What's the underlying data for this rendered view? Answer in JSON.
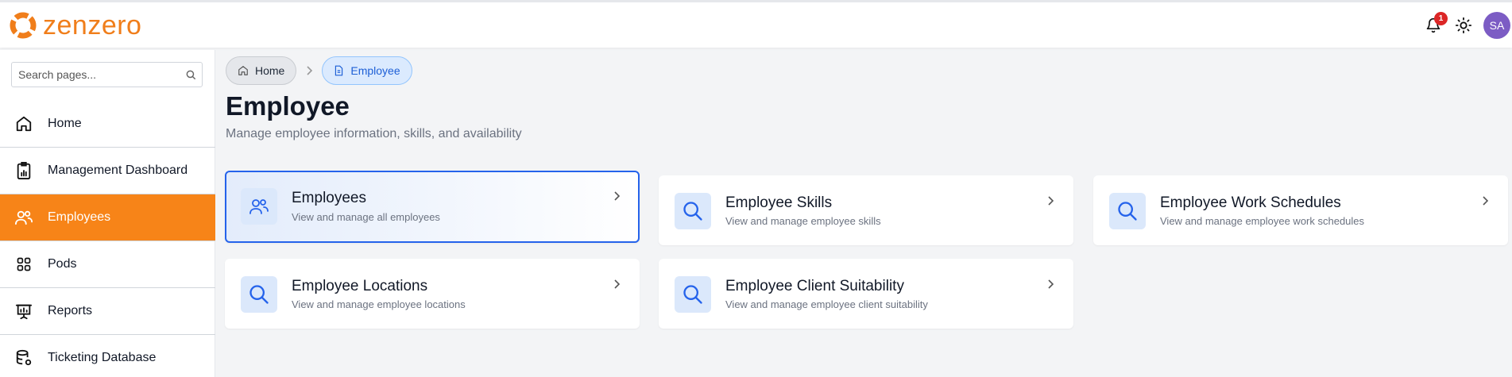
{
  "app": {
    "name": "zenzero",
    "brand_color": "#f07e1b"
  },
  "header": {
    "notification_count": "1",
    "avatar_initials": "SA"
  },
  "sidebar": {
    "search_placeholder": "Search pages...",
    "items": [
      {
        "label": "Home",
        "icon": "home-icon",
        "active": false
      },
      {
        "label": "Management Dashboard",
        "icon": "dashboard-icon",
        "active": false
      },
      {
        "label": "Employees",
        "icon": "users-icon",
        "active": true
      },
      {
        "label": "Pods",
        "icon": "grid-icon",
        "active": false
      },
      {
        "label": "Reports",
        "icon": "presentation-icon",
        "active": false
      },
      {
        "label": "Ticketing Database",
        "icon": "database-icon",
        "active": false
      }
    ]
  },
  "breadcrumb": {
    "home": "Home",
    "current": "Employee"
  },
  "page": {
    "title": "Employee",
    "subtitle": "Manage employee information, skills, and availability"
  },
  "cards": [
    {
      "title": "Employees",
      "description": "View and manage all employees",
      "icon": "users-icon",
      "selected": true
    },
    {
      "title": "Employee Skills",
      "description": "View and manage employee skills",
      "icon": "search-icon",
      "selected": false
    },
    {
      "title": "Employee Work Schedules",
      "description": "View and manage employee work schedules",
      "icon": "search-icon",
      "selected": false
    },
    {
      "title": "Employee Locations",
      "description": "View and manage employee locations",
      "icon": "search-icon",
      "selected": false
    },
    {
      "title": "Employee Client Suitability",
      "description": "View and manage employee client suitability",
      "icon": "search-icon",
      "selected": false
    }
  ],
  "colors": {
    "accent": "#f78418",
    "primary": "#2563eb",
    "badge": "#dc2626",
    "avatar": "#7c5cc4"
  }
}
